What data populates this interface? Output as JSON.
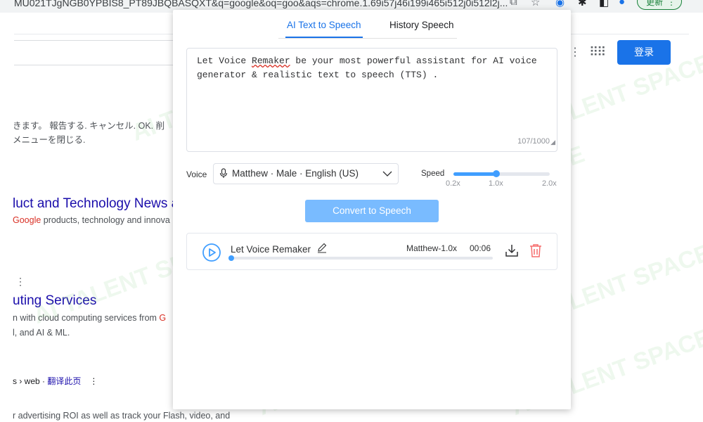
{
  "browser": {
    "url": "MU021TJgNGB0YPBIS8_PT89JBQBASQXT&q=google&oq=goo&aqs=chrome.1.69i57j46i199i465i512j0i512l2j...",
    "update_label": "更新"
  },
  "google_page": {
    "login_label": "登录",
    "snippet_line1": "きます。 報告する. キャンセル. OK. 削",
    "snippet_line2": "メニューを閉じる.",
    "result1_title": "luct and Technology News a",
    "result1_desc_red": "Google",
    "result1_desc": " products, technology and innova",
    "result2_title": "uting Services",
    "result2_desc1_pre": "n with cloud computing services from ",
    "result2_desc1_red": "G",
    "result2_desc2": "l, and AI & ML.",
    "result3_meta_pre": "s › web · ",
    "result3_meta_link": "翻译此页",
    "result3_desc": "r advertising ROI as well as track your Flash, video, and"
  },
  "watermark": "AI TALENT SPACE",
  "popup": {
    "tabs": [
      {
        "label": "AI Text to Speech",
        "active": true
      },
      {
        "label": "History Speech",
        "active": false
      }
    ],
    "text_prefix": "Let Voice ",
    "text_squiggle": "Remaker",
    "text_rest": " be your most powerful assistant for AI voice generator & realistic text to speech (TTS) .",
    "char_count": "107/1000",
    "voice_label": "Voice",
    "voice_value": "Matthew · Male · English (US)",
    "speed_label": "Speed",
    "speed": {
      "min": 0.2,
      "max": 2.0,
      "value": 1.0,
      "ticks": [
        "0.2x",
        "1.0x",
        "2.0x"
      ]
    },
    "convert_label": "Convert to Speech",
    "history_item": {
      "title": "Let Voice Remaker",
      "voice_speed": "Matthew-1.0x",
      "duration": "00:06",
      "progress": 0.0
    }
  },
  "colors": {
    "accent": "#1a73e8",
    "slider": "#409eff",
    "button": "#79bbff",
    "delete": "#f56c6c"
  }
}
